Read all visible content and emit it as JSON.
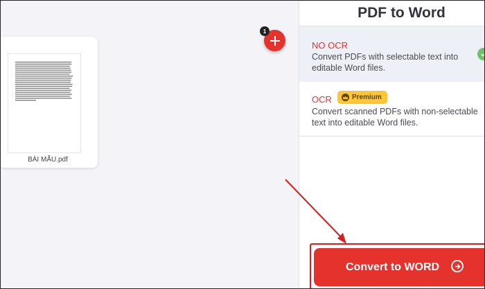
{
  "file": {
    "name": "BÀI MẪU.pdf"
  },
  "add_button": {
    "badge": "1",
    "icon": "plus-icon"
  },
  "sidebar": {
    "title": "PDF to Word",
    "options": [
      {
        "title": "NO OCR",
        "description": "Convert PDFs with selectable text into editable Word files.",
        "selected": true
      },
      {
        "title": "OCR",
        "badge": "Premium",
        "description": "Convert scanned PDFs with non-selectable text into editable Word files.",
        "selected": false
      }
    ]
  },
  "convert": {
    "label": "Convert to WORD",
    "icon": "arrow-right-circle-icon"
  },
  "colors": {
    "accent": "#e5322d",
    "premium": "#fec637",
    "check": "#6bc26b",
    "annotation": "#d42020"
  }
}
